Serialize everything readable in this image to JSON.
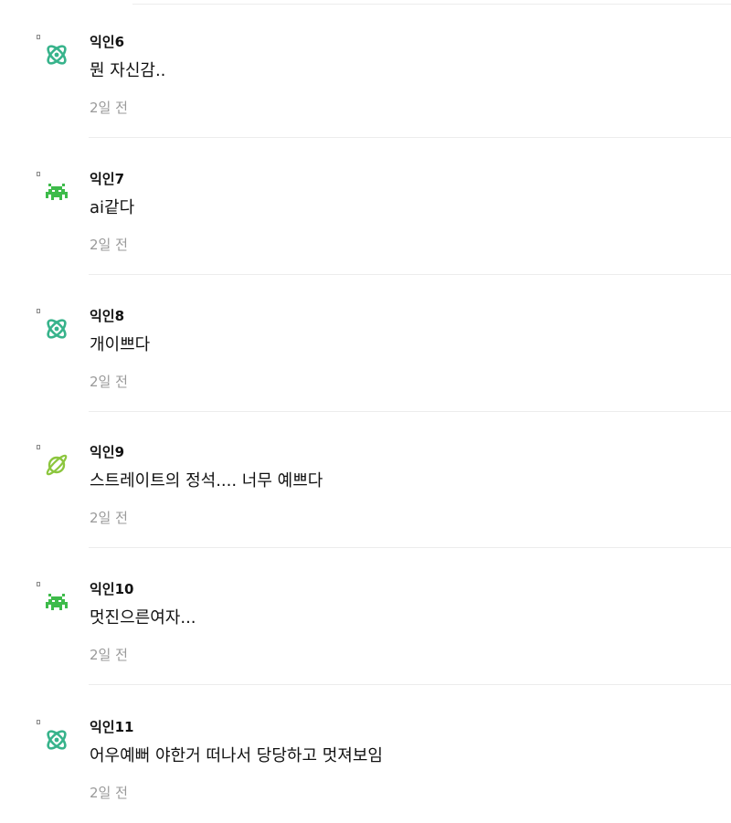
{
  "comments": [
    {
      "author": "익인6",
      "content": "뭔 자신감..",
      "time": "2일 전",
      "avatar_icon": "atom-icon",
      "avatar_color": "#37b38b"
    },
    {
      "author": "익인7",
      "content": "ai같다",
      "time": "2일 전",
      "avatar_icon": "space-invader-icon",
      "avatar_color": "#3dbb4a"
    },
    {
      "author": "익인8",
      "content": "개이쁘다",
      "time": "2일 전",
      "avatar_icon": "atom-icon",
      "avatar_color": "#37b38b"
    },
    {
      "author": "익인9",
      "content": "스트레이트의 정석.... 너무 예쁘다",
      "time": "2일 전",
      "avatar_icon": "planet-icon",
      "avatar_color": "#8cc63e"
    },
    {
      "author": "익인10",
      "content": "멋진으른여자...",
      "time": "2일 전",
      "avatar_icon": "space-invader-icon",
      "avatar_color": "#3dbb4a"
    },
    {
      "author": "익인11",
      "content": "어우예뻐 야한거 떠나서 당당하고 멋져보임",
      "time": "2일 전",
      "avatar_icon": "atom-icon",
      "avatar_color": "#37b38b"
    }
  ]
}
